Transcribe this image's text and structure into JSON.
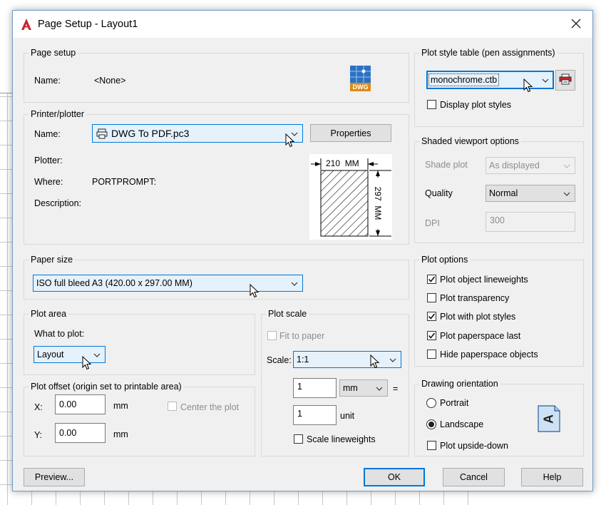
{
  "window": {
    "title": "Page Setup - Layout1"
  },
  "page_setup": {
    "group": "Page setup",
    "name_label": "Name:",
    "name_value": "<None>",
    "file_badge": "DWG"
  },
  "printer": {
    "group": "Printer/plotter",
    "name_label": "Name:",
    "name_value": "DWG To PDF.pc3",
    "properties_button": "Properties",
    "plotter_label": "Plotter:",
    "where_label": "Where:",
    "where_value": "PORTPROMPT:",
    "description_label": "Description:",
    "preview_width": "210  MM",
    "preview_height": "297  MM"
  },
  "paper_size": {
    "group": "Paper size",
    "value": "ISO full bleed A3 (420.00 x 297.00 MM)"
  },
  "plot_area": {
    "group": "Plot area",
    "what_label": "What to plot:",
    "value": "Layout"
  },
  "plot_offset": {
    "group": "Plot offset (origin set to printable area)",
    "x_label": "X:",
    "x_value": "0.00",
    "x_unit": "mm",
    "y_label": "Y:",
    "y_value": "0.00",
    "y_unit": "mm",
    "center_label": "Center the plot",
    "center_checked": false
  },
  "plot_scale": {
    "group": "Plot scale",
    "fit_label": "Fit to paper",
    "fit_checked": false,
    "scale_label": "Scale:",
    "scale_value": "1:1",
    "numerator": "1",
    "numerator_unit": "mm",
    "equals": "=",
    "denominator": "1",
    "denominator_unit": "unit",
    "lineweights_label": "Scale lineweights",
    "lineweights_checked": false
  },
  "plot_style": {
    "group": "Plot style table (pen assignments)",
    "value": "monochrome.ctb",
    "display_label": "Display plot styles",
    "display_checked": false
  },
  "shaded": {
    "group": "Shaded viewport options",
    "shade_label": "Shade plot",
    "shade_value": "As displayed",
    "quality_label": "Quality",
    "quality_value": "Normal",
    "dpi_label": "DPI",
    "dpi_value": "300"
  },
  "plot_options": {
    "group": "Plot options",
    "items": [
      {
        "label": "Plot object lineweights",
        "checked": true
      },
      {
        "label": "Plot transparency",
        "checked": false
      },
      {
        "label": "Plot with plot styles",
        "checked": true
      },
      {
        "label": "Plot paperspace last",
        "checked": true
      },
      {
        "label": "Hide paperspace objects",
        "checked": false
      }
    ]
  },
  "orientation": {
    "group": "Drawing orientation",
    "portrait": "Portrait",
    "landscape": "Landscape",
    "selected": "Landscape",
    "upside_down": "Plot upside-down",
    "upside_down_checked": false,
    "icon_letter": "A"
  },
  "footer": {
    "preview": "Preview...",
    "ok": "OK",
    "cancel": "Cancel",
    "help": "Help"
  },
  "colors": {
    "accent": "#0078d7",
    "combo_fill": "#e5f1fb",
    "dialog_bg": "#f0f0f0",
    "logo_red": "#c7252b",
    "dwg_badge": "#d88c1b"
  }
}
